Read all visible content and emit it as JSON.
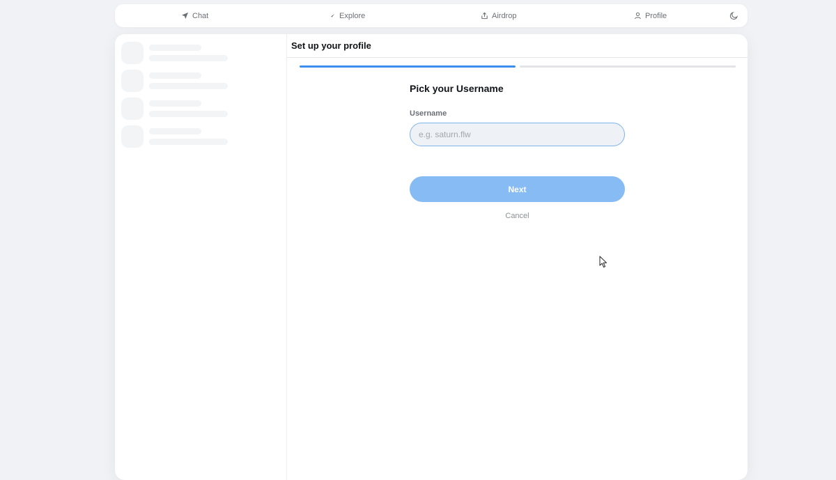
{
  "nav": {
    "chat": "Chat",
    "explore": "Explore",
    "airdrop": "Airdrop",
    "profile": "Profile",
    "theme_icon": "moon-icon"
  },
  "header": {
    "title": "Set up your profile"
  },
  "steps": {
    "current": 1,
    "total": 2
  },
  "form": {
    "title": "Pick your Username",
    "username_label": "Username",
    "username_value": "",
    "username_placeholder": "e.g. saturn.flw",
    "next_label": "Next",
    "cancel_label": "Cancel"
  },
  "colors": {
    "accent": "#3b8ef0",
    "button_disabled": "#86bbf4",
    "background": "#f1f2f5"
  }
}
